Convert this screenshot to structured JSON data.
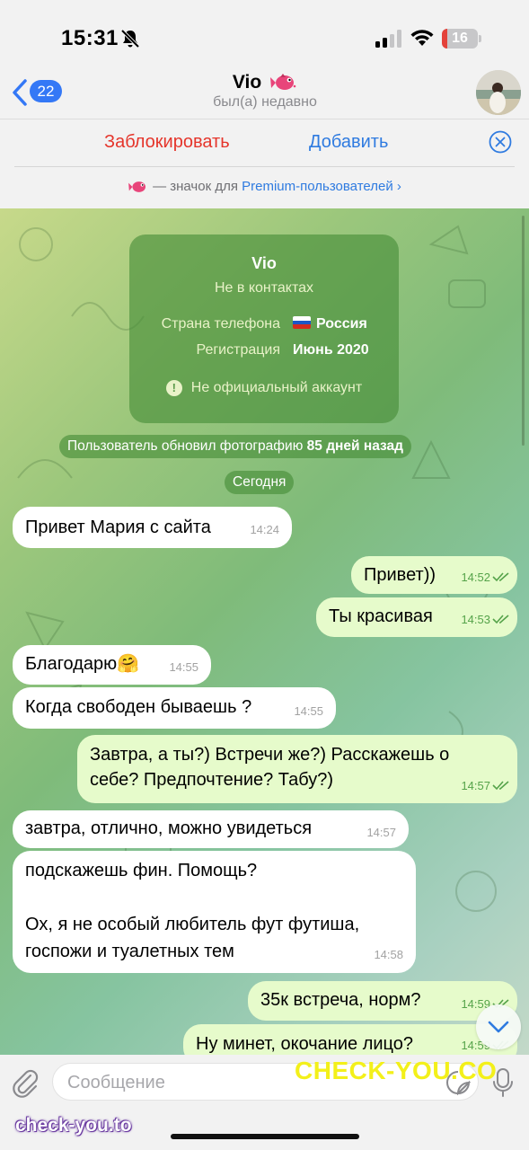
{
  "status_bar": {
    "time": "15:31",
    "battery": "16",
    "battery_level": 0.16,
    "battery_color": "#e4423a"
  },
  "header": {
    "back_count": "22",
    "title": "Vio",
    "subtitle": "был(а) недавно",
    "accent": "#3478f6"
  },
  "actions": {
    "block_label": "Заблокировать",
    "add_label": "Добавить",
    "block_color": "#e5352b",
    "add_color": "#2f7be0"
  },
  "premium_notice": {
    "text": "— значок для",
    "link": "Premium-пользователей"
  },
  "info_card": {
    "name": "Vio",
    "status": "Не в контактах",
    "phone_country_label": "Страна телефона",
    "phone_country_value": "Россия",
    "registration_label": "Регистрация",
    "registration_value": "Июнь 2020",
    "warning": "Не официальный аккаунт"
  },
  "service_messages": {
    "photo_update_prefix": "Пользователь обновил фотографию",
    "photo_update_bold": "85 дней назад",
    "date_separator": "Сегодня"
  },
  "messages": [
    {
      "dir": "in",
      "text": "Привет Мария с сайта",
      "time": "14:24"
    },
    {
      "dir": "out",
      "text": "Привет))",
      "time": "14:52",
      "read": true
    },
    {
      "dir": "out",
      "text": "Ты красивая",
      "time": "14:53",
      "read": true
    },
    {
      "dir": "in",
      "text": "Благодарю🤗",
      "time": "14:55"
    },
    {
      "dir": "in",
      "text": "Когда свободен бываешь ?",
      "time": "14:55"
    },
    {
      "dir": "out",
      "lines": [
        "Завтра, а ты?) Встречи же?) Расскажешь о",
        "себе? Предпочтение? Табу?)"
      ],
      "time": "14:57",
      "read": true
    },
    {
      "dir": "in",
      "text": "завтра, отлично, можно увидеться",
      "time": "14:57"
    },
    {
      "dir": "in",
      "lines": [
        "подскажешь фин. Помощь?",
        "",
        "Ох, я не особый любитель фут футиша,",
        "госпожи и туалетных тем"
      ],
      "time": "14:58"
    },
    {
      "dir": "out",
      "text": "35к встреча, норм?",
      "time": "14:59",
      "read": true
    },
    {
      "dir": "out",
      "text": "Ну минет, окочание лицо?",
      "time": "14:59",
      "read": true
    }
  ],
  "input": {
    "placeholder": "Сообщение"
  },
  "watermarks": {
    "main": "CHECK-YOU.CO",
    "corner": "check-you.to"
  }
}
